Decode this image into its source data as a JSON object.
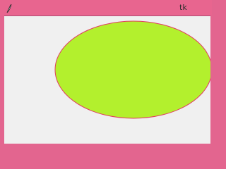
{
  "window": {
    "title": "tk",
    "icon": "feather-icon",
    "titlebar_color": "#e8658f"
  },
  "canvas": {
    "background": "#f0f0f0",
    "shape": "oval",
    "oval_fill": "#b3f02d",
    "oval_outline": "#e23a62"
  }
}
